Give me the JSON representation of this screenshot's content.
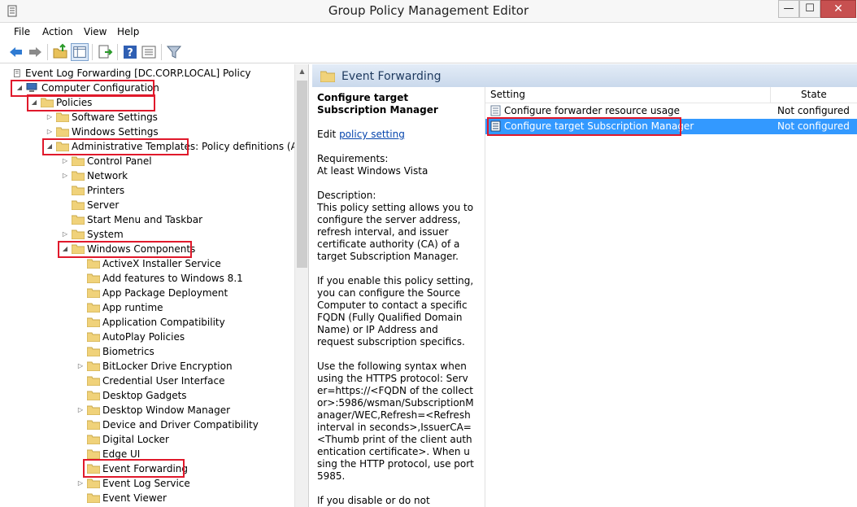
{
  "window": {
    "title": "Group Policy Management Editor",
    "minimize": "—",
    "maximize": "☐",
    "close": "✕"
  },
  "menu": [
    "File",
    "Action",
    "View",
    "Help"
  ],
  "tree": {
    "items": [
      {
        "label": "Event Log Forwarding [DC.CORP.LOCAL] Policy",
        "expander": ""
      },
      {
        "label": "Computer Configuration",
        "expander": "◢"
      },
      {
        "label": "Policies",
        "expander": "◢"
      },
      {
        "label": "Software Settings",
        "expander": "▷"
      },
      {
        "label": "Windows Settings",
        "expander": "▷"
      },
      {
        "label": "Administrative Templates: Policy definitions (ADMX",
        "expander": "◢"
      },
      {
        "label": "Control Panel",
        "expander": "▷"
      },
      {
        "label": "Network",
        "expander": "▷"
      },
      {
        "label": "Printers",
        "expander": ""
      },
      {
        "label": "Server",
        "expander": ""
      },
      {
        "label": "Start Menu and Taskbar",
        "expander": ""
      },
      {
        "label": "System",
        "expander": "▷"
      },
      {
        "label": "Windows Components",
        "expander": "◢"
      },
      {
        "label": "ActiveX Installer Service",
        "expander": ""
      },
      {
        "label": "Add features to Windows 8.1",
        "expander": ""
      },
      {
        "label": "App Package Deployment",
        "expander": ""
      },
      {
        "label": "App runtime",
        "expander": ""
      },
      {
        "label": "Application Compatibility",
        "expander": ""
      },
      {
        "label": "AutoPlay Policies",
        "expander": ""
      },
      {
        "label": "Biometrics",
        "expander": ""
      },
      {
        "label": "BitLocker Drive Encryption",
        "expander": "▷"
      },
      {
        "label": "Credential User Interface",
        "expander": ""
      },
      {
        "label": "Desktop Gadgets",
        "expander": ""
      },
      {
        "label": "Desktop Window Manager",
        "expander": "▷"
      },
      {
        "label": "Device and Driver Compatibility",
        "expander": ""
      },
      {
        "label": "Digital Locker",
        "expander": ""
      },
      {
        "label": "Edge UI",
        "expander": ""
      },
      {
        "label": "Event Forwarding",
        "expander": ""
      },
      {
        "label": "Event Log Service",
        "expander": "▷"
      },
      {
        "label": "Event Viewer",
        "expander": ""
      }
    ]
  },
  "right": {
    "header_title": "Event Forwarding",
    "description": {
      "title": "Configure target Subscription Manager",
      "edit_prefix": "Edit ",
      "edit_link": "policy setting",
      "requirements_label": "Requirements:",
      "requirements_value": "At least Windows Vista",
      "description_label": "Description:",
      "para1": "This policy setting allows you to configure the server address, refresh interval, and issuer certificate authority (CA) of a target Subscription Manager.",
      "para2": "If you enable this policy setting, you can configure the Source Computer to contact a specific FQDN (Fully Qualified Domain Name) or IP Address and request subscription specifics.",
      "para3": "Use the following syntax when using the HTTPS protocol: Server=https://<FQDN of the collector>:5986/wsman/SubscriptionManager/WEC,Refresh=<Refresh interval in seconds>,IssuerCA=<Thumb print of the client authentication certificate>. When using the HTTP protocol, use port 5985.",
      "para4": "If you disable or do not configure this"
    },
    "list": {
      "col_setting": "Setting",
      "col_state": "State",
      "rows": [
        {
          "name": "Configure forwarder resource usage",
          "state": "Not configured"
        },
        {
          "name": "Configure target Subscription Manager",
          "state": "Not configured"
        }
      ]
    }
  },
  "colors": {
    "accent": "#3399ff",
    "highlight": "#e0192b",
    "link": "#0645ad"
  }
}
